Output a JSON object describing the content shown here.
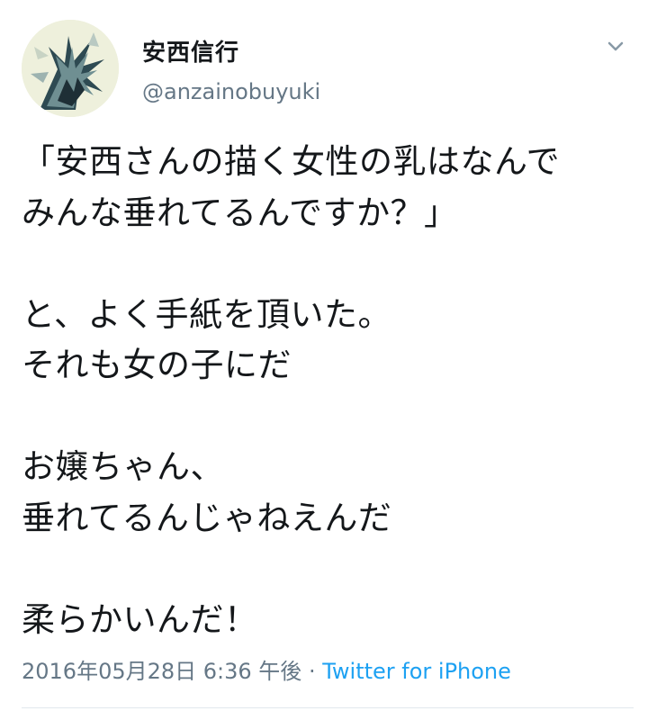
{
  "user": {
    "display_name": "安西信行",
    "handle": "@anzainobuyuki"
  },
  "tweet": {
    "lines": [
      "「安西さんの描く女性の乳はなんで",
      "みんな垂れてるんですか？」",
      "",
      "と、よく手紙を頂いた。",
      "それも女の子にだ",
      "",
      "お嬢ちゃん、",
      "垂れてるんじゃねえんだ",
      "",
      "柔らかいんだ！"
    ],
    "timestamp": "2016年05月28日 6:36 午後",
    "separator": " · ",
    "source": "Twitter for iPhone"
  },
  "icons": {
    "menu": "chevron-down-icon"
  },
  "colors": {
    "text": "#14171a",
    "secondary": "#657786",
    "link": "#1da1f2"
  }
}
